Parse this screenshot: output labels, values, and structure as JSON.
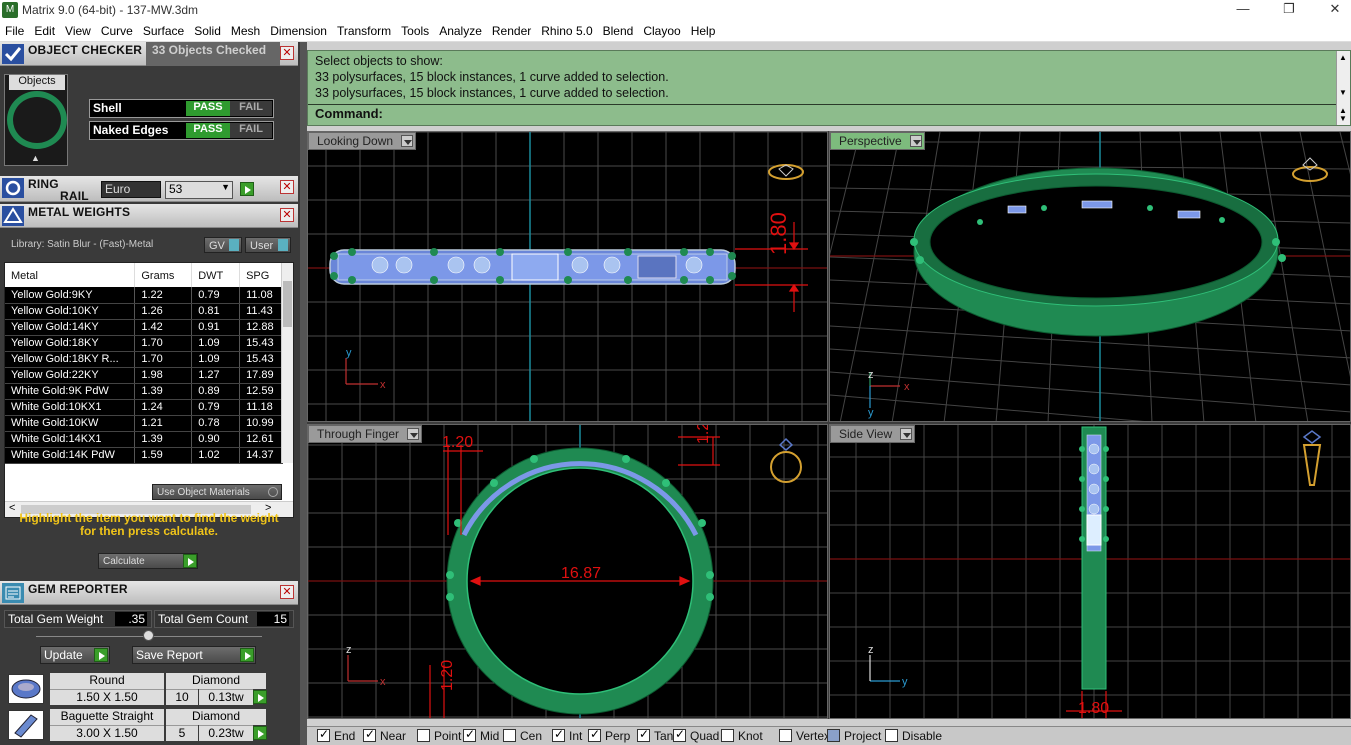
{
  "window": {
    "title": "Matrix 9.0 (64-bit) - 137-MW.3dm",
    "min": "—",
    "max": "❐",
    "close": "✕"
  },
  "menu": [
    "File",
    "Edit",
    "View",
    "Curve",
    "Surface",
    "Solid",
    "Mesh",
    "Dimension",
    "Transform",
    "Tools",
    "Analyze",
    "Render",
    "Rhino 5.0",
    "Blend",
    "Clayoo",
    "Help"
  ],
  "object_checker": {
    "title": "OBJECT CHECKER",
    "status": "33  Objects Checked",
    "objects_label": "Objects",
    "rows": [
      {
        "label": "Shell",
        "pass": "PASS",
        "fail": "FAIL"
      },
      {
        "label": "Naked Edges",
        "pass": "PASS",
        "fail": "FAIL"
      }
    ]
  },
  "ring_rail": {
    "title_1": "RING",
    "title_2": "RAIL",
    "standard": "Euro",
    "size": "53"
  },
  "metal_weights": {
    "title": "METAL WEIGHTS",
    "library": "Library: Satin Blur - (Fast)-Metal",
    "gv": "GV",
    "user": "User",
    "columns": [
      "Metal",
      "Grams",
      "DWT",
      "SPG"
    ],
    "rows": [
      [
        "Yellow Gold:9KY",
        "1.22",
        "0.79",
        "11.08"
      ],
      [
        "Yellow Gold:10KY",
        "1.26",
        "0.81",
        "11.43"
      ],
      [
        "Yellow Gold:14KY",
        "1.42",
        "0.91",
        "12.88"
      ],
      [
        "Yellow Gold:18KY",
        "1.70",
        "1.09",
        "15.43"
      ],
      [
        "Yellow Gold:18KY R...",
        "1.70",
        "1.09",
        "15.43"
      ],
      [
        "Yellow Gold:22KY",
        "1.98",
        "1.27",
        "17.89"
      ],
      [
        "White Gold:9K PdW",
        "1.39",
        "0.89",
        "12.59"
      ],
      [
        "White Gold:10KX1",
        "1.24",
        "0.79",
        "11.18"
      ],
      [
        "White Gold:10KW",
        "1.21",
        "0.78",
        "10.99"
      ],
      [
        "White Gold:14KX1",
        "1.39",
        "0.90",
        "12.61"
      ],
      [
        "White Gold:14K PdW",
        "1.59",
        "1.02",
        "14.37"
      ]
    ],
    "use_object_materials": "Use Object Materials",
    "hint": "Highlight the item you want to find the weight for then press calculate.",
    "calculate": "Calculate"
  },
  "gem_reporter": {
    "title": "GEM REPORTER",
    "total_weight_label": "Total Gem Weight",
    "total_weight": ".35",
    "total_count_label": "Total Gem Count",
    "total_count": "15",
    "update": "Update",
    "save_report": "Save Report",
    "gems": [
      {
        "shape": "Round",
        "size": "1.50 X 1.50",
        "material": "Diamond",
        "count": "10",
        "weight": "0.13tw"
      },
      {
        "shape": "Baguette Straight",
        "size": "3.00 X 1.50",
        "material": "Diamond",
        "count": "5",
        "weight": "0.23tw"
      }
    ]
  },
  "command": {
    "lines": [
      "Select objects to show:",
      "33 polysurfaces, 15 block instances, 1 curve added to selection.",
      "33 polysurfaces, 15 block instances, 1 curve added to selection."
    ],
    "prompt": "Command:"
  },
  "viewports": {
    "top_left": "Looking Down",
    "top_right": "Perspective",
    "bottom_left": "Through Finger",
    "bottom_right": "Side View"
  },
  "dimensions": {
    "height": "1.80",
    "width_a": "1.20",
    "width_b": "1.20",
    "diameter": "16.87",
    "side_a": "1.20",
    "side_b": "1.80"
  },
  "axes": {
    "x": "x",
    "y": "y",
    "z": "z"
  },
  "osnaps": [
    {
      "label": "End",
      "on": true
    },
    {
      "label": "Near",
      "on": true
    },
    {
      "label": "Point",
      "on": false
    },
    {
      "label": "Mid",
      "on": true
    },
    {
      "label": "Cen",
      "on": false
    },
    {
      "label": "Int",
      "on": true
    },
    {
      "label": "Perp",
      "on": true
    },
    {
      "label": "Tan",
      "on": true
    },
    {
      "label": "Quad",
      "on": true
    },
    {
      "label": "Knot",
      "on": false
    },
    {
      "label": "Vertex",
      "on": false
    },
    {
      "label": "Project",
      "on": true
    },
    {
      "label": "Disable",
      "on": false
    }
  ],
  "colors": {
    "ring_green": "#1f8a52",
    "command_bg": "#8dbc8c",
    "dim_red": "#e01010",
    "hint_yellow": "#f0c419"
  }
}
